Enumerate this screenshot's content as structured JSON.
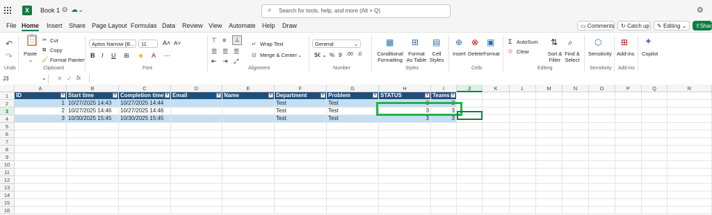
{
  "app": {
    "workbook_title": "Book 1",
    "search_placeholder": "Search for tools, help, and more (Alt + Q)"
  },
  "menu_tabs": [
    "File",
    "Home",
    "Insert",
    "Share",
    "Page Layout",
    "Formulas",
    "Data",
    "Review",
    "View",
    "Automate",
    "Help",
    "Draw"
  ],
  "menu_active": "Home",
  "right_buttons": {
    "comments": "Comments",
    "catchup": "Catch up",
    "editing": "Editing",
    "share": "Shar"
  },
  "ribbon": {
    "undo_label": "Undo",
    "clipboard": {
      "paste": "Paste",
      "cut": "Cut",
      "copy": "Copy",
      "format_painter": "Format Painter",
      "group": "Clipboard"
    },
    "font": {
      "family": "Aptos Narrow (B...",
      "size": "11",
      "group": "Font"
    },
    "alignment": {
      "wrap": "Wrap Text",
      "merge": "Merge & Center",
      "group": "Alignment"
    },
    "number": {
      "format": "General",
      "group": "Number"
    },
    "styles": {
      "conditional": "Conditional Formatting",
      "format_as_table": "Format As Table",
      "cell_styles": "Cell Styles",
      "group": "Styles"
    },
    "cells": {
      "insert": "Insert",
      "delete": "Delete",
      "format": "Format",
      "group": "Cells"
    },
    "editing": {
      "autosum": "AutoSum",
      "clear": "Clear",
      "sort": "Sort & Filter",
      "find": "Find & Select",
      "group": "Editing"
    },
    "sensitivity": {
      "label": "Sensitivity",
      "group": "Sensitivity"
    },
    "addins": {
      "label": "Add-ins",
      "group": "Add-ins"
    },
    "copilot": "Copilot"
  },
  "formula_bar": {
    "name_box": "J3",
    "fx": "fx",
    "value": ""
  },
  "columns": [
    "A",
    "B",
    "C",
    "D",
    "E",
    "F",
    "G",
    "H",
    "I",
    "J",
    "K",
    "L",
    "M",
    "N",
    "O",
    "P",
    "Q",
    "R"
  ],
  "selected_column": "J",
  "rows": [
    "1",
    "2",
    "3",
    "4",
    "5",
    "6",
    "7",
    "8",
    "9",
    "10",
    "11",
    "12",
    "13",
    "14",
    "15",
    "16"
  ],
  "selected_row": "3",
  "table": {
    "headers": [
      "ID",
      "Start time",
      "Completion time",
      "Email",
      "Name",
      "Department",
      "Problem",
      "STATUS",
      "Teams"
    ],
    "data": [
      [
        "1",
        "10/27/2025 14:43",
        "10/27/2025 14:44",
        "",
        "",
        "Test",
        "Test",
        "3",
        "2"
      ],
      [
        "2",
        "10/27/2025 14:46",
        "10/27/2025 14:46",
        "",
        "",
        "Test",
        "Test",
        "3",
        "3"
      ],
      [
        "3",
        "10/30/2025 15:45",
        "10/30/2025 15:45",
        "",
        "",
        "Test",
        "Test",
        "3",
        "3"
      ]
    ]
  },
  "colors": {
    "accent": "#107c41",
    "table_header": "#1f4e79",
    "band": "#c6def1",
    "highlight_box": "#22b04b"
  }
}
